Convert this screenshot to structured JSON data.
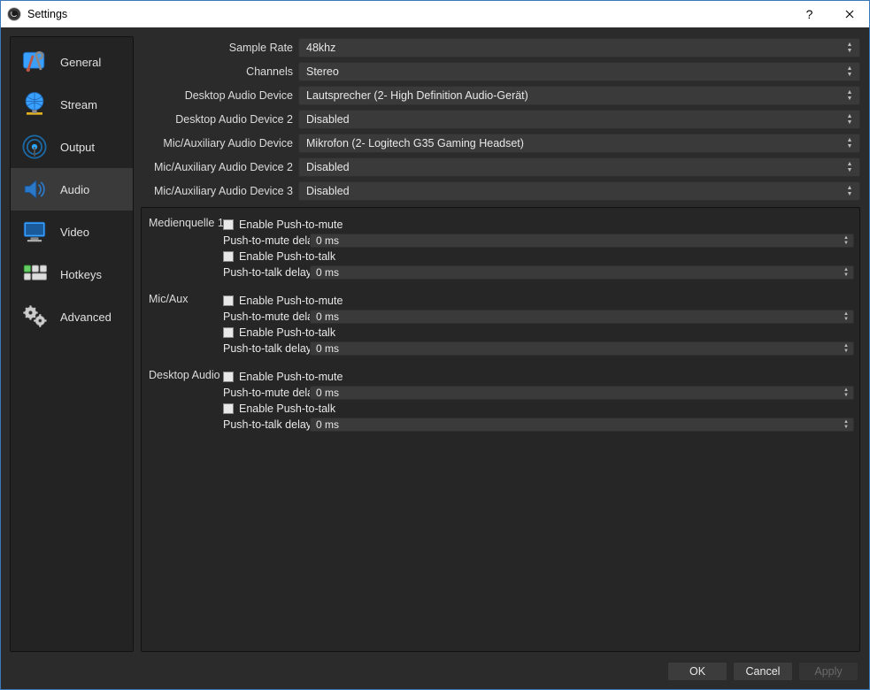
{
  "window": {
    "title": "Settings"
  },
  "sidebar": {
    "items": [
      {
        "label": "General"
      },
      {
        "label": "Stream"
      },
      {
        "label": "Output"
      },
      {
        "label": "Audio"
      },
      {
        "label": "Video"
      },
      {
        "label": "Hotkeys"
      },
      {
        "label": "Advanced"
      }
    ]
  },
  "audio_fields": {
    "rows": [
      {
        "label": "Sample Rate",
        "value": "48khz"
      },
      {
        "label": "Channels",
        "value": "Stereo"
      },
      {
        "label": "Desktop Audio Device",
        "value": "Lautsprecher (2- High Definition Audio-Gerät)"
      },
      {
        "label": "Desktop Audio Device 2",
        "value": "Disabled"
      },
      {
        "label": "Mic/Auxiliary Audio Device",
        "value": "Mikrofon (2- Logitech G35 Gaming Headset)"
      },
      {
        "label": "Mic/Auxiliary Audio Device 2",
        "value": "Disabled"
      },
      {
        "label": "Mic/Auxiliary Audio Device 3",
        "value": "Disabled"
      }
    ]
  },
  "push_groups": [
    {
      "title": "Medienquelle 1",
      "ptm_label": "Enable Push-to-mute",
      "ptm_delay_label": "Push-to-mute delay",
      "ptm_delay_value": "0 ms",
      "ptt_label": "Enable Push-to-talk",
      "ptt_delay_label": "Push-to-talk delay",
      "ptt_delay_value": "0 ms"
    },
    {
      "title": "Mic/Aux",
      "ptm_label": "Enable Push-to-mute",
      "ptm_delay_label": "Push-to-mute delay",
      "ptm_delay_value": "0 ms",
      "ptt_label": "Enable Push-to-talk",
      "ptt_delay_label": "Push-to-talk delay",
      "ptt_delay_value": "0 ms"
    },
    {
      "title": "Desktop Audio",
      "ptm_label": "Enable Push-to-mute",
      "ptm_delay_label": "Push-to-mute delay",
      "ptm_delay_value": "0 ms",
      "ptt_label": "Enable Push-to-talk",
      "ptt_delay_label": "Push-to-talk delay",
      "ptt_delay_value": "0 ms"
    }
  ],
  "footer": {
    "ok": "OK",
    "cancel": "Cancel",
    "apply": "Apply"
  }
}
